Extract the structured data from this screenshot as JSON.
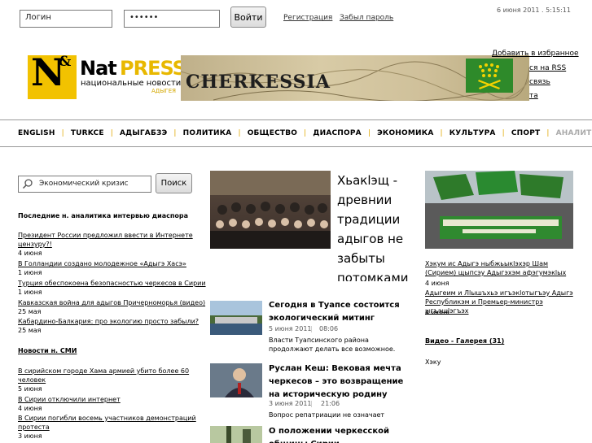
{
  "login": {
    "username_value": "Логин",
    "password_value": "••••••",
    "submit_label": "Войти",
    "register_label": "Регистрация",
    "forgot_label": "Забыл пароль"
  },
  "datetime": "6 июня 2011 . 5:15:11",
  "logo": {
    "n": "N",
    "amp": "&",
    "nat": "Nat",
    "press": "PRESS",
    "subtitle": "национальные новости",
    "subtitle2": "АДЫГЕЯ"
  },
  "banner_text": "CHERKESSIA",
  "side_links": [
    "Добавить в избранное",
    "ся на RSS",
    "связь",
    "та"
  ],
  "nav": [
    "ENGLISH",
    "TURKCE",
    "АДЫГАБЗЭ",
    "ПОЛИТИКА",
    "ОБЩЕСТВО",
    "ДИАСПОРА",
    "ЭКОНОМИКА",
    "КУЛЬТУРА",
    "СПОРТ",
    "АНАЛИТИ"
  ],
  "search": {
    "value": "Экономический кризис",
    "button_label": "Поиск"
  },
  "left": {
    "heading": "Последние н. аналитика интервью диаспора",
    "items": [
      {
        "title": "Президент России предложил ввести в Интернете цензуру?!",
        "date": "4 июня"
      },
      {
        "title": "В Голландии создано молодежное «Адыгэ Хасэ»",
        "date": "1 июня"
      },
      {
        "title": "Турция обеспокоена безопасностью черкесов в Сирии",
        "date": "1 июня"
      },
      {
        "title": "Кавказская война для адыгов Причерноморья (видео)",
        "date": "25 мая"
      },
      {
        "title": "Кабардино-Балкария: про экологию просто забыли?",
        "date": "25 мая"
      }
    ],
    "media_heading": "Новости н. СМИ",
    "media_items": [
      {
        "title": "В сирийском городе Хама армией убито более 60 человек",
        "date": "5 июня"
      },
      {
        "title": "В Сирии отключили интернет",
        "date": "4 июня"
      },
      {
        "title": "В Сирии погибли восемь участников демонстраций протеста",
        "date": "3 июня"
      }
    ]
  },
  "main": {
    "headline": "Хьакlэщ - древнии традиции адыгов не забыты потомками",
    "news": [
      {
        "title": "Сегодня в Туапсе состоится экологический митинг",
        "date": "5 июня 2011",
        "time": "08:06",
        "text": "Власти Туапсинского района продолжают делать все возможное."
      },
      {
        "title": "Руслан Кеш: Вековая мечта черкесов – это возвращение на историческую родину",
        "date": "3 июня 2011",
        "time": "21:06",
        "text": "Вопрос репатриации не означает"
      },
      {
        "title": "О положении черкесской общины Сирии",
        "date": "",
        "time": "",
        "text": ""
      }
    ]
  },
  "right": {
    "item1": "Хэкум ис Адыгэ ныбжьыкlэхэр Шам (Сирием) щыпсэу Адыгэхэм афэгумэкlых",
    "item1_date": "4 июня",
    "item2": "Адыгеим и Лlышъхьэ игъэкlотыгъэу Адыгэ Республикэм и Премьер-министрэ ыгъэшlэгъэх",
    "item2_date": "4 июня",
    "video_gallery": "Видео - Галерея (31)",
    "tail": "Хэку"
  },
  "colors": {
    "accent": "#f2c200",
    "press": "#e8b800",
    "separator": "#e0a800"
  }
}
